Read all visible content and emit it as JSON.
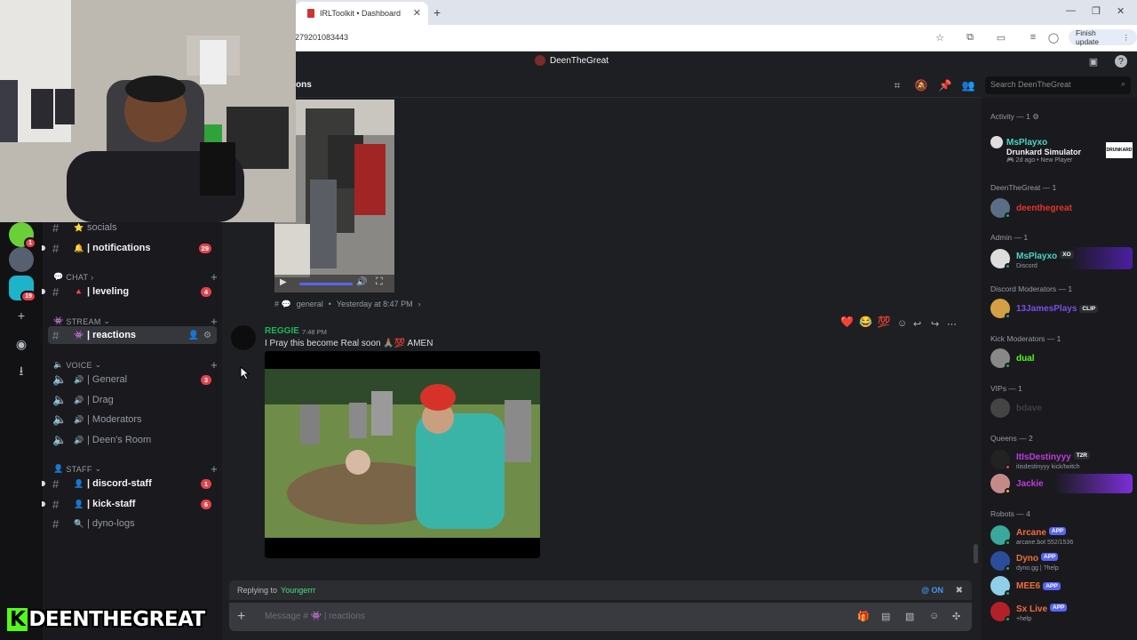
{
  "browser": {
    "tab_title": "IRLToolkit • Dashboard",
    "url": "279201083443",
    "finish_update": "Finish update"
  },
  "server": {
    "name": "DeenTheGreat"
  },
  "channel_header": {
    "name": "ons"
  },
  "search": {
    "placeholder": "Search DeenTheGreat"
  },
  "channels": {
    "top": [
      {
        "emoji": "⭐",
        "label": "socials",
        "unread": false
      },
      {
        "emoji": "🔔",
        "label": "| notifications",
        "badge": "29",
        "unread": true
      }
    ],
    "chat_category": "CHAT",
    "chat": [
      {
        "emoji": "🔺",
        "label": "| leveling",
        "badge": "4",
        "unread": true
      }
    ],
    "stream_category": "STREAM",
    "stream": [
      {
        "emoji": "👾",
        "label": "| reactions",
        "active": true
      }
    ],
    "voice_category": "VOICE",
    "voice": [
      {
        "label": "| General",
        "badge": "3"
      },
      {
        "label": "| Drag"
      },
      {
        "label": "| Moderators"
      },
      {
        "label": "| Deen's Room"
      }
    ],
    "staff_category": "STAFF",
    "staff": [
      {
        "label": "| discord-staff",
        "badge": "1",
        "unread": true
      },
      {
        "label": "| kick-staff",
        "badge": "6",
        "unread": true
      },
      {
        "label": "| dyno-logs",
        "unread": false
      }
    ]
  },
  "servers": {
    "badge1": "1",
    "badge2": "19"
  },
  "messages": {
    "video_meta_channel": "general",
    "video_meta_time": "Yesterday at 8:47 PM",
    "author": "REGGIE",
    "time": "7:48 PM",
    "text": "I Pray this become Real soon 🙏🏽💯 AMEN",
    "reactions": [
      "❤️",
      "😂",
      "💯"
    ]
  },
  "composer": {
    "replying_label": "Replying to",
    "replying_user": "Youngerrr",
    "on_label": "ON",
    "placeholder": "Message # 👾 | reactions"
  },
  "members": {
    "activity_header": "Activity — 1",
    "activity": {
      "name": "MsPlayxo",
      "game": "Drunkard Simulator",
      "time": "2d ago",
      "detail": "New Player"
    },
    "groups": [
      {
        "title": "DeenTheGreat — 1",
        "members": [
          {
            "name": "deenthegreat",
            "color": "#e8322a"
          }
        ]
      },
      {
        "title": "Admin — 1",
        "members": [
          {
            "name": "MsPlayxo",
            "color": "#4ad6c4",
            "tag": "XO",
            "sub": "Discord"
          }
        ]
      },
      {
        "title": "Discord Moderators — 1",
        "members": [
          {
            "name": "13JamesPlays",
            "color": "#7b4ee5",
            "tag": "CLIP"
          }
        ]
      },
      {
        "title": "Kick Moderators — 1",
        "members": [
          {
            "name": "dual",
            "color": "#53fc18"
          }
        ]
      },
      {
        "title": "VIPs — 1",
        "members": [
          {
            "name": "bdave",
            "color": "#404040"
          }
        ]
      },
      {
        "title": "Queens — 2",
        "members": [
          {
            "name": "ItIsDestinyyy",
            "color": "#c03ae0",
            "tag": "T2R",
            "sub": "itisdestinyyy kick/twitch"
          },
          {
            "name": "Jackie",
            "color": "#c03ae0"
          }
        ]
      },
      {
        "title": "Robots — 4",
        "members": [
          {
            "name": "Arcane",
            "color": "#f26d3d",
            "tag": "APP",
            "sub": "arcane.bot 552/1536"
          },
          {
            "name": "Dyno",
            "color": "#f26d3d",
            "tag": "APP",
            "sub": "dyno.gg | ?help"
          },
          {
            "name": "MEE6",
            "color": "#f26d3d",
            "tag": "APP"
          },
          {
            "name": "Sx Live",
            "color": "#f26d3d",
            "tag": "APP",
            "sub": "+help"
          }
        ]
      }
    ]
  },
  "overlay": {
    "k": "K",
    "name": "DEENTHEGREAT"
  },
  "colors": {
    "accent": "#5865f2",
    "kick_green": "#53fc18",
    "badge_red": "#e2434b"
  }
}
